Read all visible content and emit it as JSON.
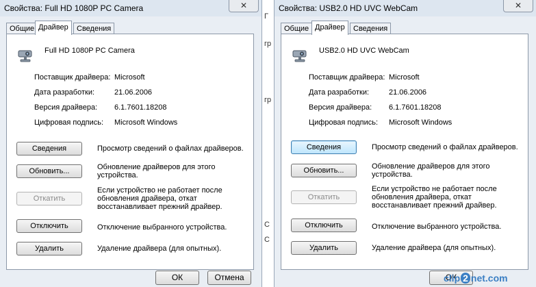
{
  "left_window": {
    "title": "Свойства: Full HD 1080P PC Camera",
    "close_symbol": "✕",
    "tabs": [
      {
        "label": "Общие"
      },
      {
        "label": "Драйвер"
      },
      {
        "label": "Сведения"
      }
    ],
    "active_tab": "Драйвер",
    "device_icon": "webcam-icon",
    "device_name": "Full HD 1080P PC Camera",
    "properties": [
      {
        "label": "Поставщик драйвера:",
        "value": "Microsoft"
      },
      {
        "label": "Дата разработки:",
        "value": "21.06.2006"
      },
      {
        "label": "Версия драйвера:",
        "value": "6.1.7601.18208"
      },
      {
        "label": "Цифровая подпись:",
        "value": "Microsoft Windows"
      }
    ],
    "actions": [
      {
        "button": "Сведения",
        "description": "Просмотр сведений о файлах драйверов."
      },
      {
        "button": "Обновить...",
        "description": "Обновление драйверов для этого\nустройства."
      },
      {
        "button": "Откатить",
        "description": "Если устройство не работает после\nобновления драйвера, откат\nвосстанавливает прежний драйвер."
      },
      {
        "button": "Отключить",
        "description": "Отключение выбранного устройства."
      },
      {
        "button": "Удалить",
        "description": "Удаление драйвера (для опытных)."
      }
    ],
    "ok_label": "ОК",
    "cancel_label": "Отмена"
  },
  "right_window": {
    "title": "Свойства: USB2.0 HD UVC WebCam",
    "close_symbol": "✕",
    "tabs": [
      {
        "label": "Общие"
      },
      {
        "label": "Драйвер"
      },
      {
        "label": "Сведения"
      }
    ],
    "active_tab": "Драйвер",
    "device_icon": "webcam-icon",
    "device_name": "USB2.0 HD UVC WebCam",
    "properties": [
      {
        "label": "Поставщик драйвера:",
        "value": "Microsoft"
      },
      {
        "label": "Дата разработки:",
        "value": "21.06.2006"
      },
      {
        "label": "Версия драйвера:",
        "value": "6.1.7601.18208"
      },
      {
        "label": "Цифровая подпись:",
        "value": "Microsoft Windows"
      }
    ],
    "actions": [
      {
        "button": "Сведения",
        "description": "Просмотр сведений о файлах драйверов."
      },
      {
        "button": "Обновить...",
        "description": "Обновление драйверов для этого\nустройства."
      },
      {
        "button": "Откатить",
        "description": "Если устройство не работает после\nобновления драйвера, откат\nвосстанавливает прежний драйвер."
      },
      {
        "button": "Отключить",
        "description": "Отключение выбранного устройства."
      },
      {
        "button": "Удалить",
        "description": "Удаление драйвера (для опытных)."
      }
    ],
    "ok_label": "ОК"
  },
  "background_fragments": [
    "Г",
    "гр",
    "гр",
    "С",
    "С"
  ],
  "watermark": {
    "left": "clip",
    "middle": "2",
    "right": "net.com"
  },
  "colors": {
    "window_frame": "#e9eef4",
    "titlebar": "#dde6f0",
    "panel": "#ffffff",
    "focus_blue": "#3c7fb1",
    "watermark": "#3b7fc4"
  }
}
